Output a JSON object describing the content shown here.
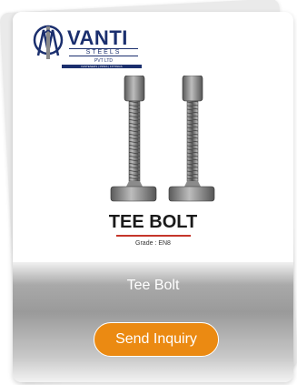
{
  "logo": {
    "brand": "VANTI",
    "sub": "STEELS",
    "sub2": "PVT LTD",
    "tagline": "FASTENERS | PIPES | FITTINGS"
  },
  "product": {
    "image_title": "TEE BOLT",
    "grade": "Grade : EN8",
    "caption": "Tee Bolt"
  },
  "actions": {
    "send_inquiry": "Send Inquiry"
  },
  "colors": {
    "brand": "#1b2f6e",
    "button": "#eb8a12",
    "rule": "#c5362b"
  }
}
